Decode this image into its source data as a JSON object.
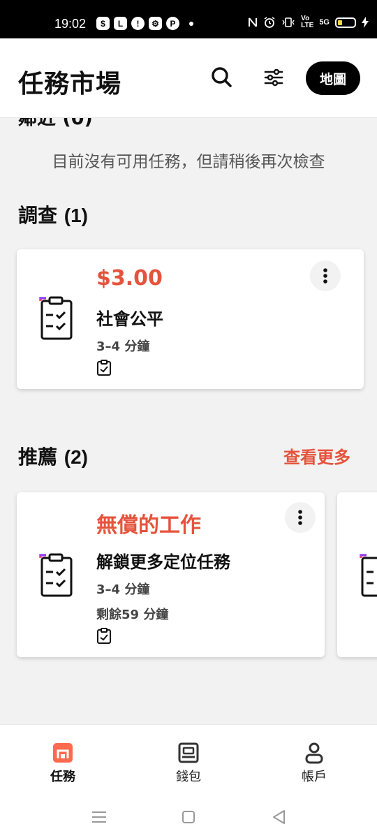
{
  "status_bar": {
    "time": "19:02",
    "left_icons": [
      "$",
      "L",
      "!",
      "⚙",
      "P"
    ],
    "network": "5G"
  },
  "header": {
    "title": "任務市場",
    "map_label": "地圖"
  },
  "sections": {
    "clipped_heading": "鄰近 (0)",
    "empty_message": "目前沒有可用任務，但請稍後再次檢查",
    "survey": {
      "title": "調查",
      "count": "(1)"
    },
    "recommended": {
      "title": "推薦",
      "count": "(2)",
      "see_more": "查看更多"
    }
  },
  "survey_card": {
    "price": "$3.00",
    "name": "社會公平",
    "duration": "3–4 分鐘"
  },
  "recommended_card": {
    "price": "無償的工作",
    "name": "解鎖更多定位任務",
    "duration": "3–4 分鐘",
    "remaining": "剩餘59 分鐘"
  },
  "bottom_nav": {
    "tasks": "任務",
    "wallet": "錢包",
    "account": "帳戶"
  },
  "colors": {
    "accent": "#e5533c",
    "icon_gradient": [
      "#8a3ffc",
      "#ff5a4a"
    ]
  }
}
